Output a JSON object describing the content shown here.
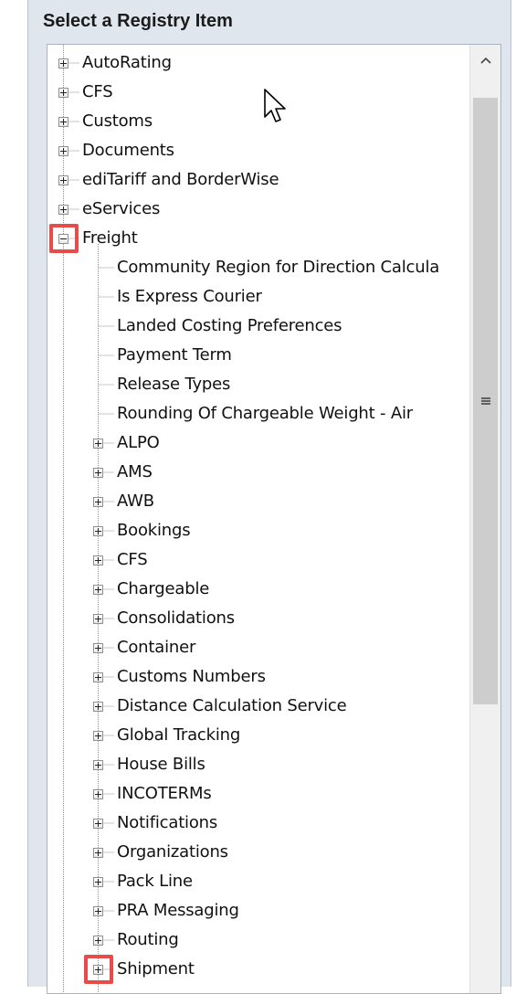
{
  "panel": {
    "title": "Select a Registry Item"
  },
  "colors": {
    "highlight": "#e74c4c",
    "background": "#dfe6ee",
    "tree_lines": "#8f8f8f"
  },
  "icons": {
    "expand": "plus-box-icon",
    "collapse": "minus-box-icon",
    "scroll_up": "chevron-up-icon",
    "thumb_grip": "grip-icon",
    "pointer": "mouse-pointer-icon"
  },
  "tree": {
    "items": [
      {
        "label": "AutoRating",
        "level": 0,
        "state": "collapsed"
      },
      {
        "label": "CFS",
        "level": 0,
        "state": "collapsed"
      },
      {
        "label": "Customs",
        "level": 0,
        "state": "collapsed"
      },
      {
        "label": "Documents",
        "level": 0,
        "state": "collapsed"
      },
      {
        "label": "ediTariff and BorderWise",
        "level": 0,
        "state": "collapsed"
      },
      {
        "label": "eServices",
        "level": 0,
        "state": "collapsed"
      },
      {
        "label": "Freight",
        "level": 0,
        "state": "expanded",
        "highlighted": true
      },
      {
        "label": "Community Region for Direction Calcula",
        "level": 1,
        "state": "leaf"
      },
      {
        "label": "Is Express Courier",
        "level": 1,
        "state": "leaf"
      },
      {
        "label": "Landed Costing Preferences",
        "level": 1,
        "state": "leaf"
      },
      {
        "label": "Payment Term",
        "level": 1,
        "state": "leaf"
      },
      {
        "label": "Release Types",
        "level": 1,
        "state": "leaf"
      },
      {
        "label": "Rounding Of Chargeable Weight - Air",
        "level": 1,
        "state": "leaf"
      },
      {
        "label": "ALPO",
        "level": 1,
        "state": "collapsed"
      },
      {
        "label": "AMS",
        "level": 1,
        "state": "collapsed"
      },
      {
        "label": "AWB",
        "level": 1,
        "state": "collapsed"
      },
      {
        "label": "Bookings",
        "level": 1,
        "state": "collapsed"
      },
      {
        "label": "CFS",
        "level": 1,
        "state": "collapsed"
      },
      {
        "label": "Chargeable",
        "level": 1,
        "state": "collapsed"
      },
      {
        "label": "Consolidations",
        "level": 1,
        "state": "collapsed"
      },
      {
        "label": "Container",
        "level": 1,
        "state": "collapsed"
      },
      {
        "label": "Customs Numbers",
        "level": 1,
        "state": "collapsed"
      },
      {
        "label": "Distance Calculation Service",
        "level": 1,
        "state": "collapsed"
      },
      {
        "label": "Global Tracking",
        "level": 1,
        "state": "collapsed"
      },
      {
        "label": "House Bills",
        "level": 1,
        "state": "collapsed"
      },
      {
        "label": "INCOTERMs",
        "level": 1,
        "state": "collapsed"
      },
      {
        "label": "Notifications",
        "level": 1,
        "state": "collapsed"
      },
      {
        "label": "Organizations",
        "level": 1,
        "state": "collapsed"
      },
      {
        "label": "Pack Line",
        "level": 1,
        "state": "collapsed"
      },
      {
        "label": "PRA Messaging",
        "level": 1,
        "state": "collapsed"
      },
      {
        "label": "Routing",
        "level": 1,
        "state": "collapsed"
      },
      {
        "label": "Shipment",
        "level": 1,
        "state": "collapsed",
        "highlighted": true
      }
    ]
  }
}
